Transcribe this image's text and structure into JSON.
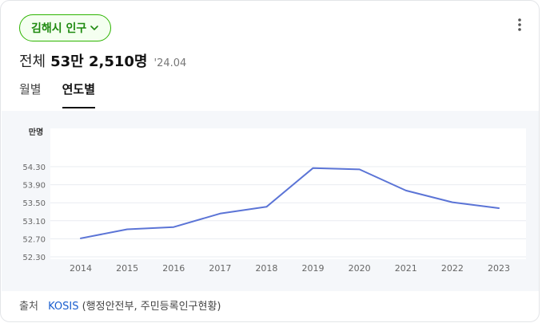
{
  "header": {
    "chip_label": "김해시 인구",
    "more_icon": "more-vertical-icon",
    "total_label": "전체",
    "total_value": "53만 2,510명",
    "date": "'24.04"
  },
  "tabs": [
    {
      "label": "월별",
      "active": false
    },
    {
      "label": "연도별",
      "active": true
    }
  ],
  "colors": {
    "accent": "#2db400",
    "line": "#5b74d6",
    "chart_bg": "#f5f7fa"
  },
  "chart_data": {
    "type": "line",
    "unit_label": "만명",
    "x": [
      "2014",
      "2015",
      "2016",
      "2017",
      "2018",
      "2019",
      "2020",
      "2021",
      "2022",
      "2023"
    ],
    "series": [
      {
        "values": [
          52.71,
          52.91,
          52.96,
          53.26,
          53.41,
          54.27,
          54.24,
          53.77,
          53.51,
          53.38
        ]
      }
    ],
    "y_ticks": [
      "52.30",
      "52.70",
      "53.10",
      "53.50",
      "53.90",
      "54.30"
    ],
    "ylim": [
      52.3,
      54.5
    ],
    "grid": true
  },
  "source": {
    "label": "출처",
    "link": "KOSIS",
    "detail": "(행정안전부, 주민등록인구현황)"
  }
}
